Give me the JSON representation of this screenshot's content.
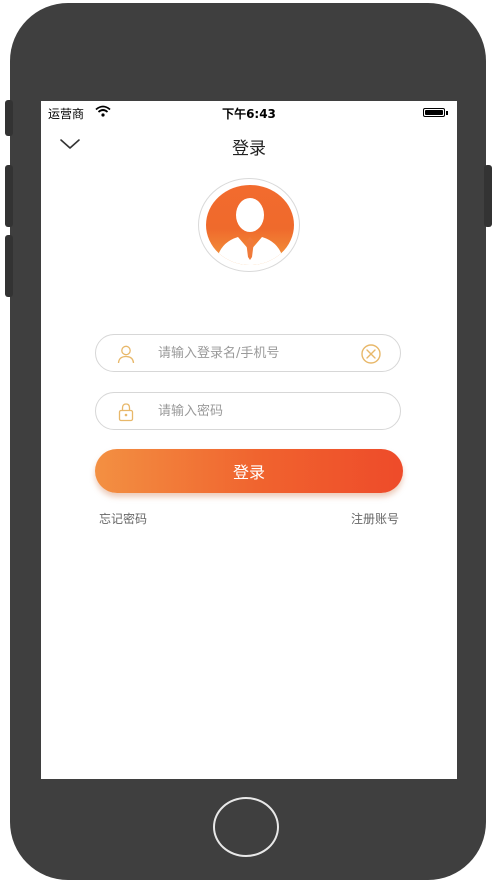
{
  "status_bar": {
    "carrier": "运营商",
    "time": "下午6:43"
  },
  "nav": {
    "title": "登录",
    "back_icon": "chevron-down-icon"
  },
  "form": {
    "username": {
      "placeholder": "请输入登录名/手机号",
      "value": "",
      "icon": "user-icon",
      "clear_icon": "clear-icon"
    },
    "password": {
      "placeholder": "请输入密码",
      "value": "",
      "icon": "lock-icon"
    },
    "login_label": "登录"
  },
  "links": {
    "forgot_password": "忘记密码",
    "register": "注册账号"
  },
  "colors": {
    "accent_start": "#f39042",
    "accent_end": "#ee4b2a",
    "icon_gold": "#e8b86a",
    "frame": "#3f3f3f"
  }
}
